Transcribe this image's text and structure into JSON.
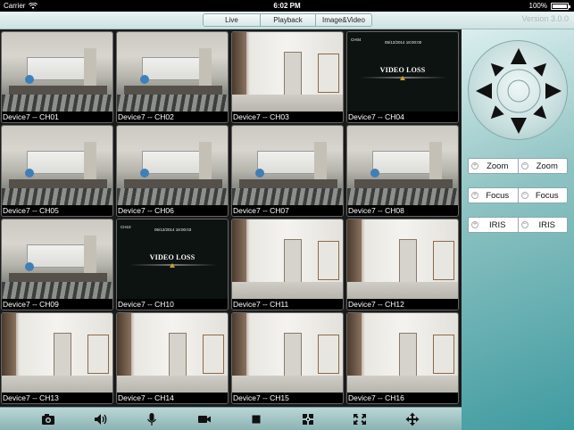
{
  "status_bar": {
    "carrier": "Carrier",
    "time": "6:02 PM",
    "battery": "100%",
    "battery_level": 1.0
  },
  "header": {
    "tabs": [
      {
        "label": "Live",
        "active": true
      },
      {
        "label": "Playback",
        "active": false
      },
      {
        "label": "Image&Video",
        "active": false
      }
    ],
    "version": "Version 3.0.0"
  },
  "accent_color": "#1a78c2",
  "channels": [
    {
      "caption": "Device7 -- CH01",
      "scene": "office",
      "overlay_label": "",
      "timestamp": ""
    },
    {
      "caption": "Device7 -- CH02",
      "scene": "office",
      "overlay_label": "",
      "timestamp": ""
    },
    {
      "caption": "Device7 -- CH03",
      "scene": "hallway",
      "overlay_label": "",
      "timestamp": ""
    },
    {
      "caption": "Device7 -- CH04",
      "scene": "video-loss",
      "overlay_label": "CH04",
      "timestamp": "05/12/2014 18:00:00",
      "loss_text": "VIDEO LOSS"
    },
    {
      "caption": "Device7 -- CH05",
      "scene": "office",
      "overlay_label": "",
      "timestamp": ""
    },
    {
      "caption": "Device7 -- CH06",
      "scene": "office",
      "overlay_label": "",
      "timestamp": ""
    },
    {
      "caption": "Device7 -- CH07",
      "scene": "office",
      "overlay_label": "",
      "timestamp": ""
    },
    {
      "caption": "Device7 -- CH08",
      "scene": "office",
      "overlay_label": "",
      "timestamp": ""
    },
    {
      "caption": "Device7 -- CH09",
      "scene": "office",
      "overlay_label": "",
      "timestamp": ""
    },
    {
      "caption": "Device7 -- CH10",
      "scene": "video-loss",
      "overlay_label": "CH10",
      "timestamp": "05/12/2014 18:00:03",
      "loss_text": "VIDEO LOSS"
    },
    {
      "caption": "Device7 -- CH11",
      "scene": "hallway",
      "overlay_label": "",
      "timestamp": ""
    },
    {
      "caption": "Device7 -- CH12",
      "scene": "hallway",
      "overlay_label": "",
      "timestamp": ""
    },
    {
      "caption": "Device7 -- CH13",
      "scene": "hallway",
      "overlay_label": "",
      "timestamp": ""
    },
    {
      "caption": "Device7 -- CH14",
      "scene": "hallway",
      "overlay_label": "",
      "timestamp": ""
    },
    {
      "caption": "Device7 -- CH15",
      "scene": "hallway",
      "overlay_label": "",
      "timestamp": ""
    },
    {
      "caption": "Device7 -- CH16",
      "scene": "hallway",
      "overlay_label": "",
      "timestamp": ""
    }
  ],
  "ptz": {
    "directions": [
      "up",
      "up-right",
      "right",
      "down-right",
      "down",
      "down-left",
      "left",
      "up-left"
    ],
    "controls": [
      {
        "minus_label": "Zoom",
        "plus_label": "Zoom"
      },
      {
        "minus_label": "Focus",
        "plus_label": "Focus"
      },
      {
        "minus_label": "IRIS",
        "plus_label": "IRIS"
      }
    ]
  },
  "toolbar": {
    "icons": [
      "snapshot-icon",
      "speaker-icon",
      "microphone-icon",
      "record-icon",
      "stop-icon",
      "split-layout-icon",
      "fullscreen-icon",
      "ptz-move-icon"
    ]
  }
}
